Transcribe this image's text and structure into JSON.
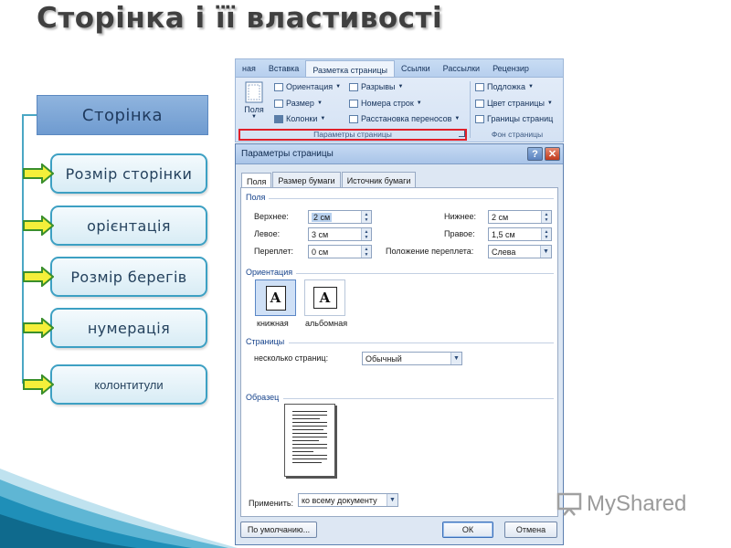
{
  "slide": {
    "title": "Сторінка і її властивості"
  },
  "diagram": {
    "root": "Сторінка",
    "items": [
      {
        "label": "Розмір сторінки"
      },
      {
        "label": "орієнтація"
      },
      {
        "label": "Розмір берегів"
      },
      {
        "label": "нумерація"
      },
      {
        "label": "колонтитули"
      }
    ]
  },
  "ribbon": {
    "tabs": [
      "ная",
      "Вставка",
      "Разметка страницы",
      "Ссылки",
      "Рассылки",
      "Рецензир"
    ],
    "active_tab": "Разметка страницы",
    "fields_button": "Поля",
    "items": {
      "orientation": "Ориентация",
      "size": "Размер",
      "columns": "Колонки",
      "breaks": "Разрывы",
      "line_numbers": "Номера строк",
      "hyphenation": "Расстановка переносов",
      "watermark": "Подложка",
      "page_color": "Цвет страницы",
      "page_borders": "Границы страниц"
    },
    "group_page_setup": "Параметры страницы",
    "group_background": "Фон страницы"
  },
  "dialog": {
    "title": "Параметры страницы",
    "tabs": [
      "Поля",
      "Размер бумаги",
      "Источник бумаги"
    ],
    "active_tab": "Поля",
    "margins_section": "Поля",
    "top_label": "Верхнее:",
    "top_value": "2 см",
    "bottom_label": "Нижнее:",
    "bottom_value": "2 см",
    "left_label": "Левое:",
    "left_value": "3 см",
    "right_label": "Правое:",
    "right_value": "1,5 см",
    "gutter_label": "Переплет:",
    "gutter_value": "0 см",
    "gutter_pos_label": "Положение переплета:",
    "gutter_pos_value": "Слева",
    "orientation_section": "Ориентация",
    "portrait_label": "книжная",
    "landscape_label": "альбомная",
    "orientation_glyph": "A",
    "pages_section": "Страницы",
    "multiple_pages_label": "несколько страниц:",
    "multiple_pages_value": "Обычный",
    "sample_section": "Образец",
    "apply_label": "Применить:",
    "apply_value": "ко всему документу",
    "default_button": "По умолчанию...",
    "ok_button": "ОК",
    "cancel_button": "Отмена"
  },
  "watermark": {
    "text": "MyShared"
  },
  "colors": {
    "accent": "#3da0c3",
    "arrow_fill": "#f4ef3a",
    "arrow_stroke": "#3a8f2c",
    "root_fill": "#7ea6d6"
  }
}
